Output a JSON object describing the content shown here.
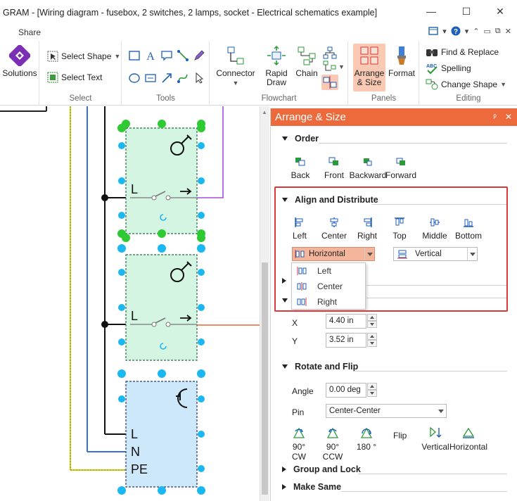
{
  "window": {
    "title": "GRAM - [Wiring diagram - fusebox, 2 switches, 2 lamps, socket - Electrical schematics example]",
    "minimize": "—",
    "maximize": "☐",
    "close": "✕"
  },
  "ribbon_tabs": {
    "share": "Share"
  },
  "ribbon": {
    "solutions": "Solutions",
    "select_group": {
      "label": "Select",
      "select_shape": "Select Shape",
      "select_text": "Select Text"
    },
    "tools_group": {
      "label": "Tools"
    },
    "flowchart_group": {
      "label": "Flowchart",
      "connector": "Connector",
      "rapid_draw_1": "Rapid",
      "rapid_draw_2": "Draw",
      "chain": "Chain"
    },
    "panels_group": {
      "label": "Panels",
      "arrange_1": "Arrange",
      "arrange_2": "& Size",
      "format": "Format"
    },
    "editing_group": {
      "label": "Editing",
      "find_replace": "Find & Replace",
      "spelling": "Spelling",
      "change_shape": "Change Shape"
    }
  },
  "canvas": {
    "switch1_label": "L",
    "switch2_label": "L",
    "socket_L": "L",
    "socket_N": "N",
    "socket_PE": "PE"
  },
  "panel": {
    "title": "Arrange & Size",
    "pin_icon": "ᵖ",
    "close_icon": "✕",
    "order": {
      "heading": "Order",
      "back": "Back",
      "front": "Front",
      "backward": "Backward",
      "forward": "Forward"
    },
    "align": {
      "heading": "Align and Distribute",
      "left": "Left",
      "center": "Center",
      "right": "Right",
      "top": "Top",
      "middle": "Middle",
      "bottom": "Bottom",
      "horizontal_value": "Horizontal",
      "vertical_value": "Vertical",
      "horizontal_options": [
        "Left",
        "Center",
        "Right"
      ]
    },
    "position": {
      "x_label": "X",
      "x_value": "4.40 in",
      "y_label": "Y",
      "y_value": "3.52 in"
    },
    "rotate": {
      "heading": "Rotate and Flip",
      "angle_label": "Angle",
      "angle_value": "0.00 deg",
      "pin_label": "Pin",
      "pin_value": "Center-Center",
      "cw90": "90° CW",
      "ccw90": "90° CCW",
      "r180": "180 °",
      "flip": "Flip",
      "vertical": "Vertical",
      "horizontal": "Horizontal"
    },
    "group_lock": "Group and Lock",
    "make_same": "Make Same"
  },
  "colors": {
    "accent": "#ed6a3c",
    "switch_fill": "#d4f5e2",
    "socket_fill": "#cde8fb",
    "handle_green": "#2fc934",
    "handle_blue": "#1ab7f0",
    "wire_purple": "#a24fd8",
    "wire_orange": "#e8662e",
    "wire_yellow": "#d9d400",
    "wire_blue": "#3a6fd6",
    "highlight_frame": "#d9383d"
  }
}
